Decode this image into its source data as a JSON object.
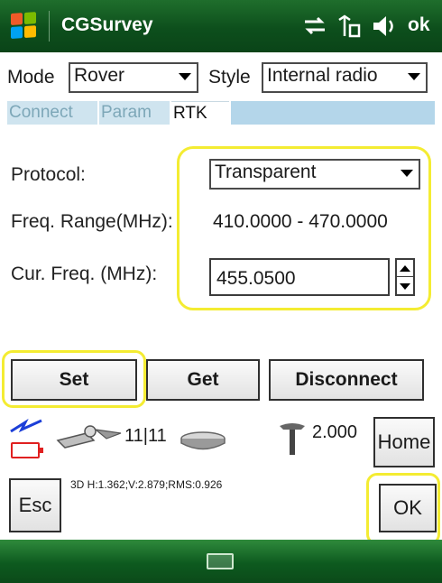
{
  "titlebar": {
    "app_title": "CGSurvey",
    "ok_label": "ok",
    "icons": [
      "windows-start-icon",
      "connectivity-icon",
      "signal-icon",
      "speaker-icon"
    ]
  },
  "mode": {
    "label": "Mode",
    "value": "Rover"
  },
  "style": {
    "label": "Style",
    "value": "Internal radio"
  },
  "tabs": [
    {
      "label": "Connect",
      "active": false
    },
    {
      "label": "Param",
      "active": false
    },
    {
      "label": "RTK",
      "active": true
    }
  ],
  "form": {
    "protocol_label": "Protocol:",
    "protocol_value": "Transparent",
    "freq_range_label": "Freq. Range(MHz):",
    "freq_range_value": "410.0000 - 470.0000",
    "cur_freq_label": "Cur. Freq. (MHz):",
    "cur_freq_value": "455.0500"
  },
  "buttons": {
    "set": "Set",
    "get": "Get",
    "disconnect": "Disconnect",
    "home": "Home",
    "esc": "Esc",
    "ok": "OK"
  },
  "status": {
    "satellites": "11|11",
    "antenna_height": "2.000",
    "precision": "3D H:1.362;V:2.879;RMS:0.926"
  },
  "colors": {
    "titlebar": "#0d4f1c",
    "highlight": "#f4ec32",
    "tab_active_bg": "#ffffff",
    "tab_strip": "#b4d6ea",
    "battery": "#e02020",
    "link_icon": "#1c3fd8"
  }
}
